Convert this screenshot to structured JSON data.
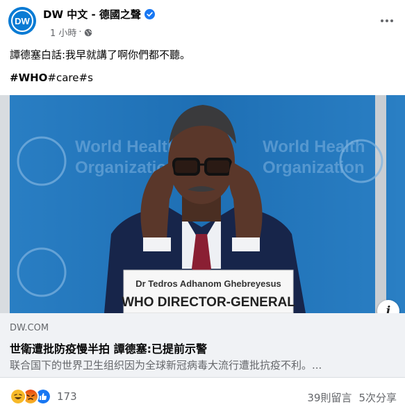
{
  "post": {
    "page_name": "DW 中文 - 德國之聲",
    "time": "1 小時",
    "dot": "·",
    "text": "譚德塞白話:我早就講了啊你們都不聽。",
    "hashtag_bold": "#WHO",
    "hashtag_rest": "#care#s"
  },
  "photo": {
    "background_text_1": "World Health",
    "background_text_2": "Organization",
    "nameplate_line_1": "Dr Tedros Adhanom Ghebreyesus",
    "nameplate_line_2": "WHO DIRECTOR-GENERAL"
  },
  "link": {
    "domain": "DW.COM",
    "headline": "世衛遭批防疫慢半拍 譚德塞:已提前示警",
    "description": "联合国下的世界卫生组织因为全球新冠病毒大流行遭批抗疫不利。..."
  },
  "footer": {
    "reaction_count": "173",
    "comments": "39則留言",
    "shares": "5次分享"
  },
  "icons": {
    "avatar": "dw-logo-icon",
    "verified": "verified-badge-icon",
    "audience": "globe-icon",
    "more": "more-options-icon",
    "info": "info-icon",
    "reactions": [
      "haha-icon",
      "angry-icon",
      "like-icon"
    ]
  },
  "colors": {
    "brand_blue": "#0a7bd4",
    "verified_blue": "#1877f2",
    "link_bg": "#f0f2f5",
    "secondary_text": "#65676b"
  }
}
